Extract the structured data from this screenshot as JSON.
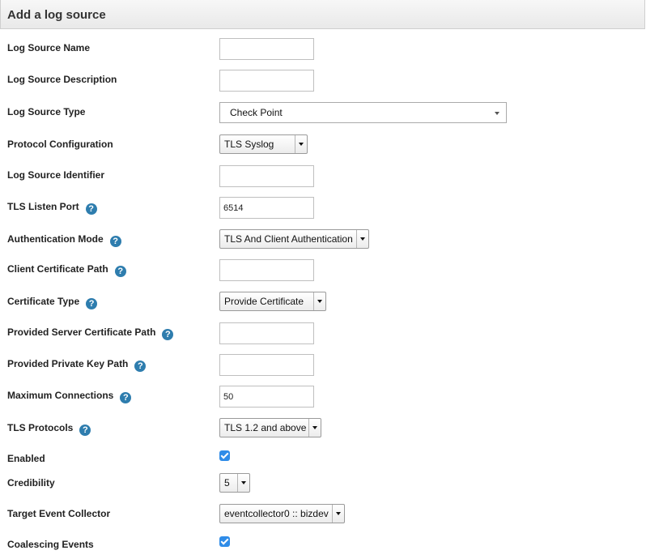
{
  "header": {
    "title": "Add a log source"
  },
  "fields": {
    "log_source_name": {
      "label": "Log Source Name",
      "value": ""
    },
    "log_source_description": {
      "label": "Log Source Description",
      "value": ""
    },
    "log_source_type": {
      "label": "Log Source Type",
      "value": "Check Point"
    },
    "protocol_configuration": {
      "label": "Protocol Configuration",
      "value": "TLS Syslog"
    },
    "log_source_identifier": {
      "label": "Log Source Identifier",
      "value": ""
    },
    "tls_listen_port": {
      "label": "TLS Listen Port",
      "value": "6514"
    },
    "authentication_mode": {
      "label": "Authentication Mode",
      "value": "TLS And Client Authentication"
    },
    "client_certificate_path": {
      "label": "Client Certificate Path",
      "value": ""
    },
    "certificate_type": {
      "label": "Certificate Type",
      "value": "Provide Certificate"
    },
    "provided_server_certificate_path": {
      "label": "Provided Server Certificate Path",
      "value": ""
    },
    "provided_private_key_path": {
      "label": "Provided Private Key Path",
      "value": ""
    },
    "maximum_connections": {
      "label": "Maximum Connections",
      "value": "50"
    },
    "tls_protocols": {
      "label": "TLS Protocols",
      "value": "TLS 1.2 and above"
    },
    "enabled": {
      "label": "Enabled",
      "checked": true
    },
    "credibility": {
      "label": "Credibility",
      "value": "5"
    },
    "target_event_collector": {
      "label": "Target Event Collector",
      "value": "eventcollector0 :: bizdev"
    },
    "coalescing_events": {
      "label": "Coalescing Events",
      "checked": true
    }
  },
  "help_icon": {
    "glyph": "?",
    "color": "#2e7dae",
    "icon": "help-icon"
  },
  "colors": {
    "checkbox": "#2f8ce8",
    "help": "#2e7dae"
  }
}
